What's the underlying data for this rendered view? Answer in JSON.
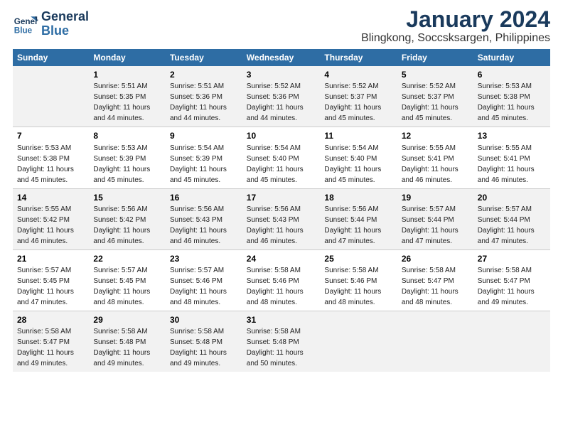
{
  "logo": {
    "line1": "General",
    "line2": "Blue"
  },
  "title": "January 2024",
  "subtitle": "Blingkong, Soccsksargen, Philippines",
  "columns": [
    "Sunday",
    "Monday",
    "Tuesday",
    "Wednesday",
    "Thursday",
    "Friday",
    "Saturday"
  ],
  "weeks": [
    [
      {
        "day": "",
        "sunrise": "",
        "sunset": "",
        "daylight": ""
      },
      {
        "day": "1",
        "sunrise": "Sunrise: 5:51 AM",
        "sunset": "Sunset: 5:35 PM",
        "daylight": "Daylight: 11 hours and 44 minutes."
      },
      {
        "day": "2",
        "sunrise": "Sunrise: 5:51 AM",
        "sunset": "Sunset: 5:36 PM",
        "daylight": "Daylight: 11 hours and 44 minutes."
      },
      {
        "day": "3",
        "sunrise": "Sunrise: 5:52 AM",
        "sunset": "Sunset: 5:36 PM",
        "daylight": "Daylight: 11 hours and 44 minutes."
      },
      {
        "day": "4",
        "sunrise": "Sunrise: 5:52 AM",
        "sunset": "Sunset: 5:37 PM",
        "daylight": "Daylight: 11 hours and 45 minutes."
      },
      {
        "day": "5",
        "sunrise": "Sunrise: 5:52 AM",
        "sunset": "Sunset: 5:37 PM",
        "daylight": "Daylight: 11 hours and 45 minutes."
      },
      {
        "day": "6",
        "sunrise": "Sunrise: 5:53 AM",
        "sunset": "Sunset: 5:38 PM",
        "daylight": "Daylight: 11 hours and 45 minutes."
      }
    ],
    [
      {
        "day": "7",
        "sunrise": "Sunrise: 5:53 AM",
        "sunset": "Sunset: 5:38 PM",
        "daylight": "Daylight: 11 hours and 45 minutes."
      },
      {
        "day": "8",
        "sunrise": "Sunrise: 5:53 AM",
        "sunset": "Sunset: 5:39 PM",
        "daylight": "Daylight: 11 hours and 45 minutes."
      },
      {
        "day": "9",
        "sunrise": "Sunrise: 5:54 AM",
        "sunset": "Sunset: 5:39 PM",
        "daylight": "Daylight: 11 hours and 45 minutes."
      },
      {
        "day": "10",
        "sunrise": "Sunrise: 5:54 AM",
        "sunset": "Sunset: 5:40 PM",
        "daylight": "Daylight: 11 hours and 45 minutes."
      },
      {
        "day": "11",
        "sunrise": "Sunrise: 5:54 AM",
        "sunset": "Sunset: 5:40 PM",
        "daylight": "Daylight: 11 hours and 45 minutes."
      },
      {
        "day": "12",
        "sunrise": "Sunrise: 5:55 AM",
        "sunset": "Sunset: 5:41 PM",
        "daylight": "Daylight: 11 hours and 46 minutes."
      },
      {
        "day": "13",
        "sunrise": "Sunrise: 5:55 AM",
        "sunset": "Sunset: 5:41 PM",
        "daylight": "Daylight: 11 hours and 46 minutes."
      }
    ],
    [
      {
        "day": "14",
        "sunrise": "Sunrise: 5:55 AM",
        "sunset": "Sunset: 5:42 PM",
        "daylight": "Daylight: 11 hours and 46 minutes."
      },
      {
        "day": "15",
        "sunrise": "Sunrise: 5:56 AM",
        "sunset": "Sunset: 5:42 PM",
        "daylight": "Daylight: 11 hours and 46 minutes."
      },
      {
        "day": "16",
        "sunrise": "Sunrise: 5:56 AM",
        "sunset": "Sunset: 5:43 PM",
        "daylight": "Daylight: 11 hours and 46 minutes."
      },
      {
        "day": "17",
        "sunrise": "Sunrise: 5:56 AM",
        "sunset": "Sunset: 5:43 PM",
        "daylight": "Daylight: 11 hours and 46 minutes."
      },
      {
        "day": "18",
        "sunrise": "Sunrise: 5:56 AM",
        "sunset": "Sunset: 5:44 PM",
        "daylight": "Daylight: 11 hours and 47 minutes."
      },
      {
        "day": "19",
        "sunrise": "Sunrise: 5:57 AM",
        "sunset": "Sunset: 5:44 PM",
        "daylight": "Daylight: 11 hours and 47 minutes."
      },
      {
        "day": "20",
        "sunrise": "Sunrise: 5:57 AM",
        "sunset": "Sunset: 5:44 PM",
        "daylight": "Daylight: 11 hours and 47 minutes."
      }
    ],
    [
      {
        "day": "21",
        "sunrise": "Sunrise: 5:57 AM",
        "sunset": "Sunset: 5:45 PM",
        "daylight": "Daylight: 11 hours and 47 minutes."
      },
      {
        "day": "22",
        "sunrise": "Sunrise: 5:57 AM",
        "sunset": "Sunset: 5:45 PM",
        "daylight": "Daylight: 11 hours and 48 minutes."
      },
      {
        "day": "23",
        "sunrise": "Sunrise: 5:57 AM",
        "sunset": "Sunset: 5:46 PM",
        "daylight": "Daylight: 11 hours and 48 minutes."
      },
      {
        "day": "24",
        "sunrise": "Sunrise: 5:58 AM",
        "sunset": "Sunset: 5:46 PM",
        "daylight": "Daylight: 11 hours and 48 minutes."
      },
      {
        "day": "25",
        "sunrise": "Sunrise: 5:58 AM",
        "sunset": "Sunset: 5:46 PM",
        "daylight": "Daylight: 11 hours and 48 minutes."
      },
      {
        "day": "26",
        "sunrise": "Sunrise: 5:58 AM",
        "sunset": "Sunset: 5:47 PM",
        "daylight": "Daylight: 11 hours and 48 minutes."
      },
      {
        "day": "27",
        "sunrise": "Sunrise: 5:58 AM",
        "sunset": "Sunset: 5:47 PM",
        "daylight": "Daylight: 11 hours and 49 minutes."
      }
    ],
    [
      {
        "day": "28",
        "sunrise": "Sunrise: 5:58 AM",
        "sunset": "Sunset: 5:47 PM",
        "daylight": "Daylight: 11 hours and 49 minutes."
      },
      {
        "day": "29",
        "sunrise": "Sunrise: 5:58 AM",
        "sunset": "Sunset: 5:48 PM",
        "daylight": "Daylight: 11 hours and 49 minutes."
      },
      {
        "day": "30",
        "sunrise": "Sunrise: 5:58 AM",
        "sunset": "Sunset: 5:48 PM",
        "daylight": "Daylight: 11 hours and 49 minutes."
      },
      {
        "day": "31",
        "sunrise": "Sunrise: 5:58 AM",
        "sunset": "Sunset: 5:48 PM",
        "daylight": "Daylight: 11 hours and 50 minutes."
      },
      {
        "day": "",
        "sunrise": "",
        "sunset": "",
        "daylight": ""
      },
      {
        "day": "",
        "sunrise": "",
        "sunset": "",
        "daylight": ""
      },
      {
        "day": "",
        "sunrise": "",
        "sunset": "",
        "daylight": ""
      }
    ]
  ]
}
